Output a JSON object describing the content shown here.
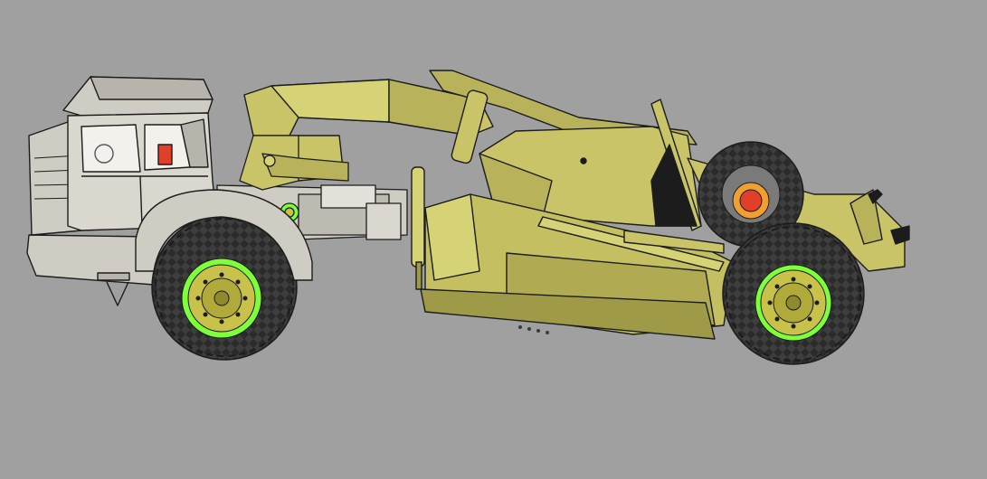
{
  "scene": {
    "subject": "",
    "background_color": "#a0a0a0",
    "colors": {
      "scraper_body": "#c9c468",
      "scraper_shadow": "#9e9a48",
      "cab": "#d9d7ce",
      "cab_shadow": "#b7b5ab",
      "tire": "#2b2b2b",
      "rim_highlight": "#7dff3a",
      "rim": "#c8c24a",
      "outline": "#1c1c1c",
      "accent_red": "#e0402a",
      "accent_orange": "#f0a030"
    }
  }
}
